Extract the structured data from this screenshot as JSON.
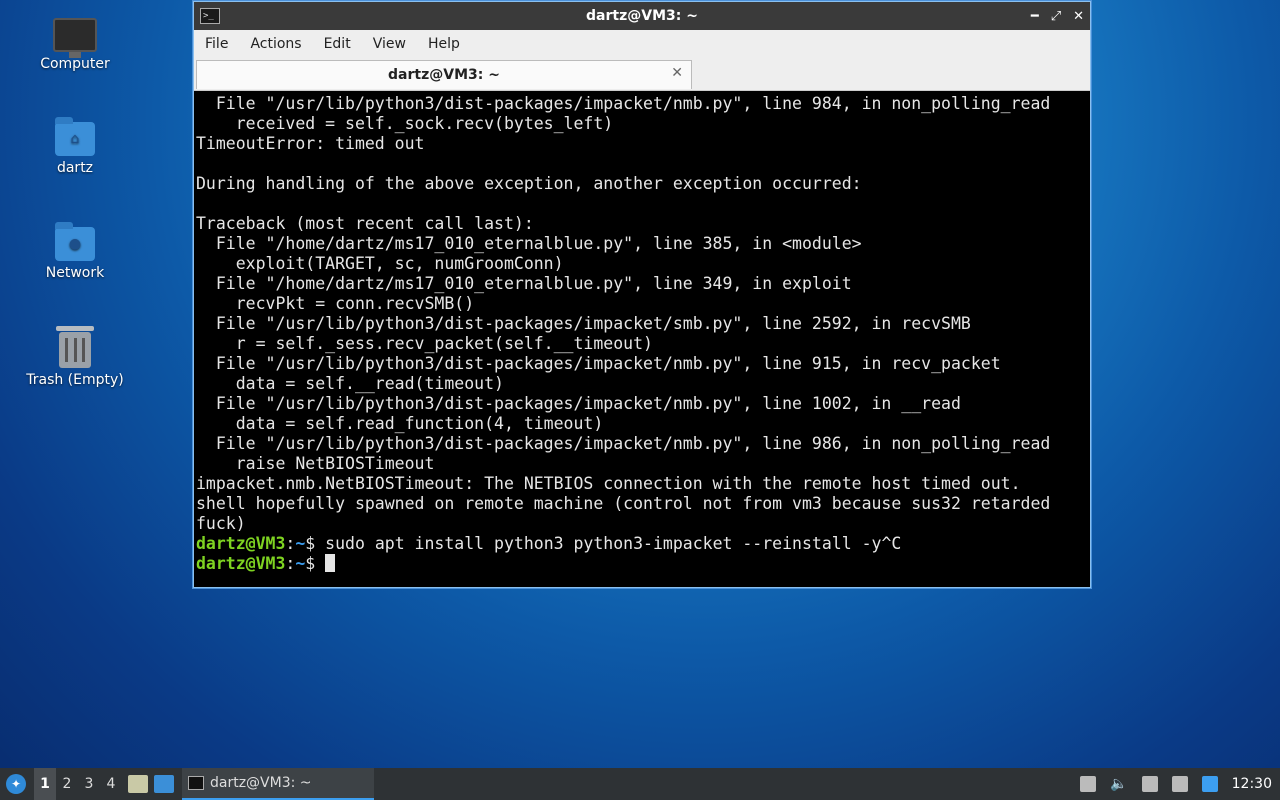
{
  "desktop": {
    "icons": [
      {
        "label": "Computer"
      },
      {
        "label": "dartz"
      },
      {
        "label": "Network"
      },
      {
        "label": "Trash (Empty)"
      }
    ]
  },
  "window": {
    "title": "dartz@VM3: ~",
    "menu": [
      "File",
      "Actions",
      "Edit",
      "View",
      "Help"
    ],
    "tab_label": "dartz@VM3: ~",
    "terminal_lines": [
      "  File \"/usr/lib/python3/dist-packages/impacket/nmb.py\", line 984, in non_polling_read",
      "    received = self._sock.recv(bytes_left)",
      "TimeoutError: timed out",
      "",
      "During handling of the above exception, another exception occurred:",
      "",
      "Traceback (most recent call last):",
      "  File \"/home/dartz/ms17_010_eternalblue.py\", line 385, in <module>",
      "    exploit(TARGET, sc, numGroomConn)",
      "  File \"/home/dartz/ms17_010_eternalblue.py\", line 349, in exploit",
      "    recvPkt = conn.recvSMB()",
      "  File \"/usr/lib/python3/dist-packages/impacket/smb.py\", line 2592, in recvSMB",
      "    r = self._sess.recv_packet(self.__timeout)",
      "  File \"/usr/lib/python3/dist-packages/impacket/nmb.py\", line 915, in recv_packet",
      "    data = self.__read(timeout)",
      "  File \"/usr/lib/python3/dist-packages/impacket/nmb.py\", line 1002, in __read",
      "    data = self.read_function(4, timeout)",
      "  File \"/usr/lib/python3/dist-packages/impacket/nmb.py\", line 986, in non_polling_read",
      "    raise NetBIOSTimeout",
      "impacket.nmb.NetBIOSTimeout: The NETBIOS connection with the remote host timed out.",
      "shell hopefully spawned on remote machine (control not from vm3 because sus32 retarded",
      "fuck)"
    ],
    "prompt_user": "dartz@VM3",
    "prompt_sep": ":",
    "prompt_path": "~",
    "prompt_sym": "$ ",
    "last_command": "sudo apt install python3 python3-impacket --reinstall -y^C"
  },
  "taskbar": {
    "workspaces": [
      "1",
      "2",
      "3",
      "4"
    ],
    "active_workspace": "1",
    "task_label": "dartz@VM3: ~",
    "clock": "12:30"
  }
}
